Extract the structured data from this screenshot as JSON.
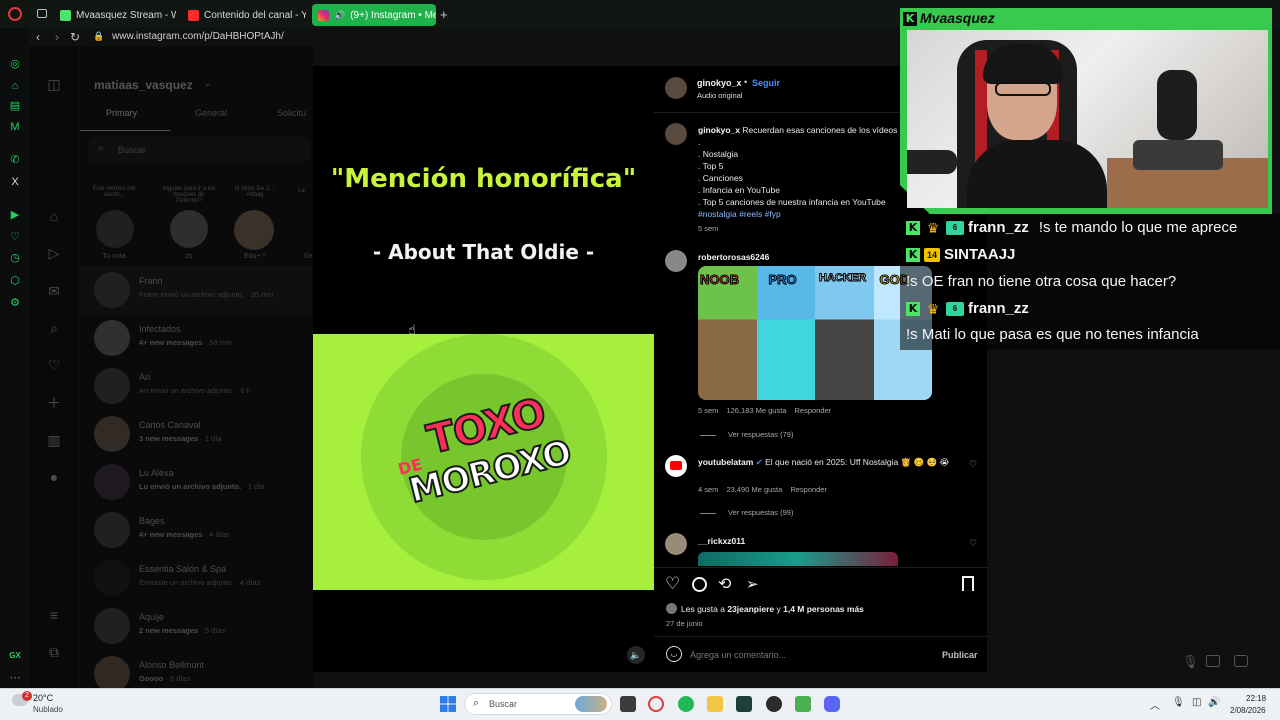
{
  "browser": {
    "tabs": [
      {
        "label": "Mvaasquez Stream - Watc"
      },
      {
        "label": "Contenido del canal - YouT"
      },
      {
        "label": "(9+) Instagram • Mens"
      }
    ],
    "add_tab": "+",
    "url": "www.instagram.com/p/DaHBHOPtAJh/"
  },
  "instagram": {
    "account": "matiaas_vasquez",
    "dm_tabs": [
      "Primary",
      "General",
      "Solicitu"
    ],
    "search_placeholder": "Buscar",
    "stories": [
      {
        "note": "Este viernes me siento...",
        "name": "Tu nota"
      },
      {
        "note": "Alguien para ir a los bosques de Palermo?",
        "name": "zo"
      },
      {
        "note": "Ill Verte De C... Aitbag",
        "name": "Edu+ ^"
      },
      {
        "note": "La",
        "name": "Ge"
      }
    ],
    "conversations": [
      {
        "name": "Frann",
        "preview": "Frann envió un archivo adjunto.",
        "time": "· 35 min"
      },
      {
        "name": "Infectados",
        "preview": "4+ new messages",
        "time": "· 58 min"
      },
      {
        "name": "Ari",
        "preview": "Ari envió un archivo adjunto.",
        "time": "· 6 h"
      },
      {
        "name": "Carlos Canaval",
        "preview": "3 new messages",
        "time": "· 1 día"
      },
      {
        "name": "Lu Alexa",
        "preview": "Lu envió un archivo adjunto.",
        "time": "· 1 día"
      },
      {
        "name": "Bages",
        "preview": "4+ new messages",
        "time": "· 4 días"
      },
      {
        "name": "Essentia Salón & Spa",
        "preview": "Enviaste un archivo adjunto.",
        "time": "· 4 días"
      },
      {
        "name": "Aquije",
        "preview": "2 new messages",
        "time": "· 5 días"
      },
      {
        "name": "Alonso Bellmunt",
        "preview": "Goooo",
        "time": "· 6 días"
      }
    ]
  },
  "post": {
    "video_title": "\"Mención honorífica\"",
    "video_subtitle": "- About That Oldie -",
    "logo_de": "DE",
    "logo_line1": "TOXO",
    "logo_line2": "MOROXO",
    "author": "ginokyo_x",
    "follow": "Seguir",
    "audio": "Audio original",
    "caption_user": "ginokyo_x",
    "caption_lines": [
      "Recuerdan esas canciones de los vídeos",
      ".",
      ". Nostalgia",
      ". Top 5",
      ". Canciones",
      ". Infancia en YouTube",
      ". Top 5 canciones de nuestra infancia en YouTube"
    ],
    "hashtags": "#nostalgia #reels #fyp",
    "caption_time": "5 sem",
    "comments": [
      {
        "user": "robertorosas6246",
        "image_labels": [
          "NOOB",
          "PRO",
          "HACKER",
          "GOD"
        ],
        "time": "5 sem",
        "likes": "126,183 Me gusta",
        "reply": "Responder",
        "view_replies": "Ver respuestas (79)"
      },
      {
        "user": "youtubelatam",
        "text": "El que nació en 2025: Uff Nostalgia 👸 🥴 🥺 😭",
        "time": "4 sem",
        "likes": "23,490 Me gusta",
        "reply": "Responder",
        "view_replies": "Ver respuestas (99)"
      },
      {
        "user": "__rickxz011"
      }
    ],
    "likes_text_prefix": "Les gusta a",
    "likes_user": "23jeanpiere",
    "likes_text_mid": "y",
    "likes_count": "1,4 M personas más",
    "date": "27 de junio",
    "comment_placeholder": "Agrega un comentario...",
    "publish": "Publicar"
  },
  "stream": {
    "channel_name": "Mvaasquez",
    "chat": [
      {
        "user": "frann_zz",
        "badges": [
          "kick",
          "crown",
          "sub"
        ],
        "message": "!s te mando lo que me aprece"
      },
      {
        "user": "SINTAAJJ",
        "badges": [
          "kick",
          "14"
        ],
        "message": ""
      },
      {
        "user": "",
        "badges": [],
        "message": "!s OE fran no tiene otra cosa que hacer?"
      },
      {
        "user": "frann_zz",
        "badges": [
          "kick",
          "crown",
          "sub"
        ],
        "message": ""
      },
      {
        "user": "",
        "badges": [],
        "message": "!s Mati lo que pasa es que no tenes infancia"
      }
    ],
    "sub_badge_text": "6",
    "num_badge_text": "14"
  },
  "taskbar": {
    "weather_temp": "20°C",
    "weather_desc": "Nublado",
    "weather_badge": "2",
    "search": "Buscar",
    "time": "22:18",
    "date": "2/08/2026"
  },
  "colors": {
    "accent_green": "#1fb14a",
    "kick_green": "#4be36a",
    "video_title_color": "#c8f53a",
    "video_bg_green": "#a6ef3c",
    "logo_red": "#ff2f5a",
    "link_blue": "#8ab8ff"
  }
}
